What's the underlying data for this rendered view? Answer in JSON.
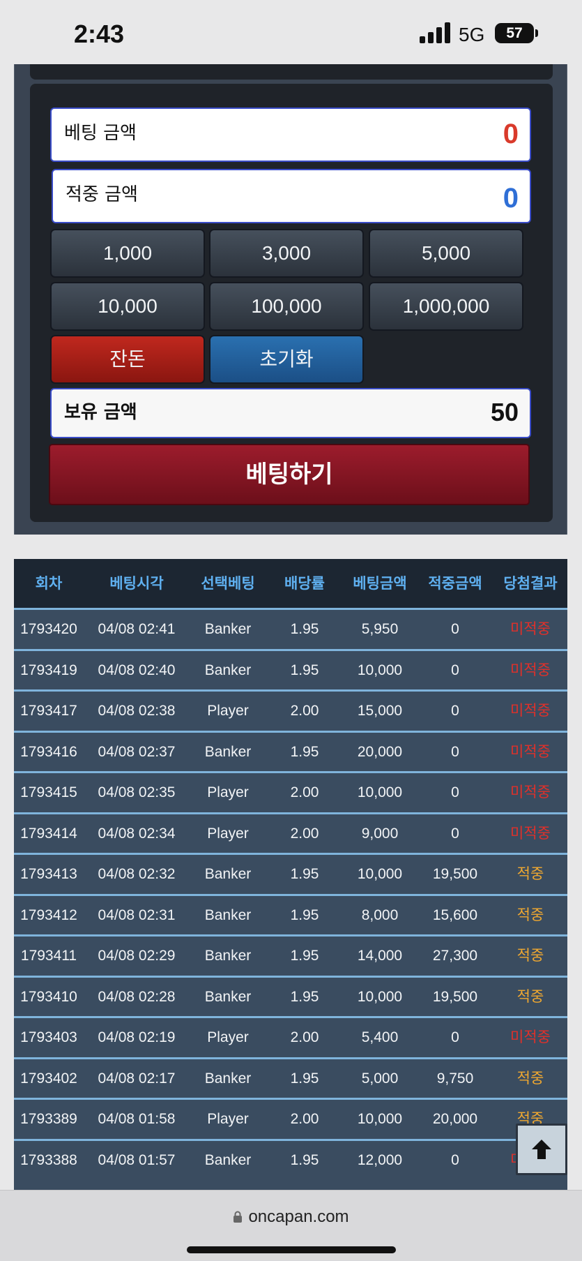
{
  "status_bar": {
    "time": "2:43",
    "network": "5G",
    "battery": "57"
  },
  "betting_panel": {
    "bet_amount_label": "베팅 금액",
    "bet_amount_value": "0",
    "win_amount_label": "적중 금액",
    "win_amount_value": "0",
    "chips": [
      "1,000",
      "3,000",
      "5,000",
      "10,000",
      "100,000",
      "1,000,000"
    ],
    "balance_all_label": "잔돈",
    "reset_label": "초기화",
    "holding_label": "보유 금액",
    "holding_value": "50",
    "bet_button_label": "베팅하기",
    "colors": {
      "bet_value": "#d93a2b",
      "win_value": "#2f6fd6"
    }
  },
  "history_table": {
    "headers": [
      "회차",
      "베팅시각",
      "선택베팅",
      "배당률",
      "베팅금액",
      "적중금액",
      "당첨결과"
    ],
    "rows": [
      [
        "1793420",
        "04/08 02:41",
        "Banker",
        "1.95",
        "5,950",
        "0",
        "미적중"
      ],
      [
        "1793419",
        "04/08 02:40",
        "Banker",
        "1.95",
        "10,000",
        "0",
        "미적중"
      ],
      [
        "1793417",
        "04/08 02:38",
        "Player",
        "2.00",
        "15,000",
        "0",
        "미적중"
      ],
      [
        "1793416",
        "04/08 02:37",
        "Banker",
        "1.95",
        "20,000",
        "0",
        "미적중"
      ],
      [
        "1793415",
        "04/08 02:35",
        "Player",
        "2.00",
        "10,000",
        "0",
        "미적중"
      ],
      [
        "1793414",
        "04/08 02:34",
        "Player",
        "2.00",
        "9,000",
        "0",
        "미적중"
      ],
      [
        "1793413",
        "04/08 02:32",
        "Banker",
        "1.95",
        "10,000",
        "19,500",
        "적중"
      ],
      [
        "1793412",
        "04/08 02:31",
        "Banker",
        "1.95",
        "8,000",
        "15,600",
        "적중"
      ],
      [
        "1793411",
        "04/08 02:29",
        "Banker",
        "1.95",
        "14,000",
        "27,300",
        "적중"
      ],
      [
        "1793410",
        "04/08 02:28",
        "Banker",
        "1.95",
        "10,000",
        "19,500",
        "적중"
      ],
      [
        "1793403",
        "04/08 02:19",
        "Player",
        "2.00",
        "5,400",
        "0",
        "미적중"
      ],
      [
        "1793402",
        "04/08 02:17",
        "Banker",
        "1.95",
        "5,000",
        "9,750",
        "적중"
      ],
      [
        "1793389",
        "04/08 01:58",
        "Player",
        "2.00",
        "10,000",
        "20,000",
        "적중"
      ],
      [
        "1793388",
        "04/08 01:57",
        "Banker",
        "1.95",
        "12,000",
        "0",
        "미적중"
      ]
    ]
  },
  "browser": {
    "url": "oncapan.com"
  },
  "icons": {
    "scroll_top": "arrow-up-icon",
    "lock": "lock-icon"
  }
}
